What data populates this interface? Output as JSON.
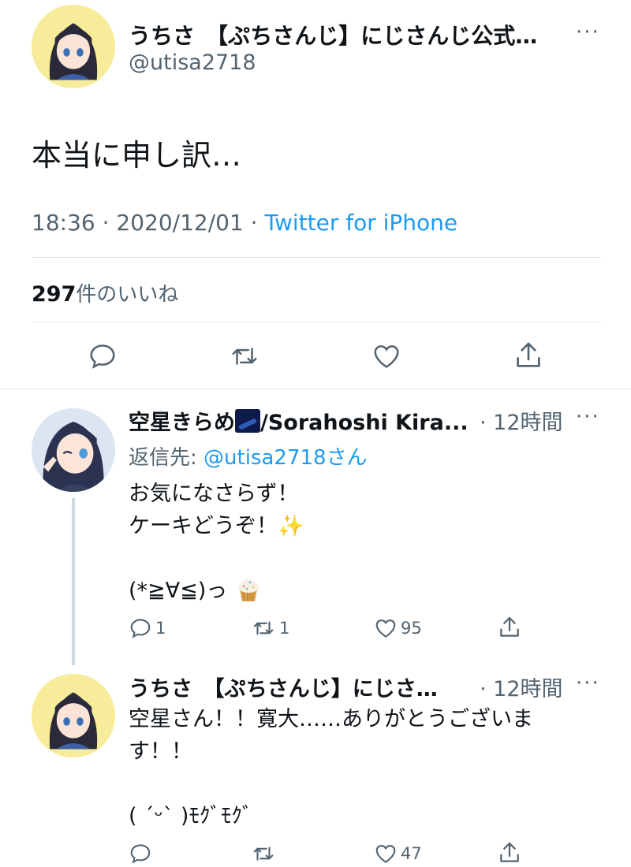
{
  "main_tweet": {
    "display_name": "うちさ　【ぷちさんじ】にじさんじ公式…",
    "handle": "@utisa2718",
    "more": "···",
    "text": "本当に申し訳…",
    "time": "18:36 · 2020/12/01 · ",
    "client": "Twitter for iPhone",
    "likes_count": "297",
    "likes_label": "件のいいね"
  },
  "replies": [
    {
      "display_name_pre": "空星きらめ",
      "display_name_post": "/Sorahoshi Kira...",
      "time": "· 12時間",
      "more": "···",
      "reply_to_label": "返信先: ",
      "reply_to_handle": "@utisa2718さん",
      "line1": "お気になさらず！",
      "line2": "ケーキどうぞ！",
      "line3": "(*≧∀≦)っ",
      "reply_count": "1",
      "retweet_count": "1",
      "like_count": "95"
    },
    {
      "display_name": "うちさ　【ぷちさんじ】にじさ…",
      "time": "· 12時間",
      "more": "···",
      "line1": "空星さん！！寛大……ありがとうございま",
      "line2": "す！！",
      "line3": "( ˊᵕˋ )ﾓｸﾞﾓｸﾞ",
      "like_count": "47"
    }
  ],
  "icons": [
    "reply-icon",
    "retweet-icon",
    "like-icon",
    "share-icon",
    "more-icon",
    "sparkles-emoji",
    "cupcake-emoji",
    "galaxy-emoji"
  ],
  "colors": {
    "link": "#1d9bf0",
    "secondary": "#536471",
    "divider": "#dfe3e6"
  }
}
